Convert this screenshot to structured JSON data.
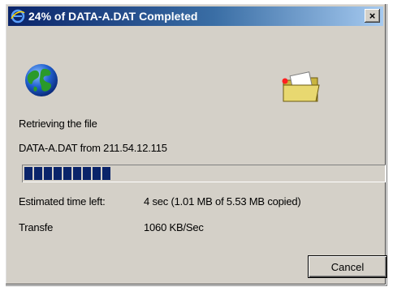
{
  "window": {
    "title": "24% of DATA-A.DAT Completed",
    "close_label": "×"
  },
  "status": {
    "action_text": "Retrieving the file",
    "source_text": "DATA-A.DAT from 211.54.12.115"
  },
  "progress": {
    "fraction": 0.24,
    "color": "#0a246a"
  },
  "details": {
    "time_left_label": "Estimated time left:",
    "time_left_value": "4 sec (1.01 MB of 5.53 MB copied)",
    "transfer_label": "Transfe",
    "transfer_value": "1060 KB/Sec"
  },
  "buttons": {
    "cancel_label": "Cancel"
  },
  "icons": {
    "title": "ie-icon",
    "source": "globe-icon",
    "destination": "folder-icon"
  },
  "colors": {
    "title_gradient_start": "#0a246a",
    "title_gradient_end": "#a6caf0",
    "dialog_background": "#d4d0c8"
  }
}
